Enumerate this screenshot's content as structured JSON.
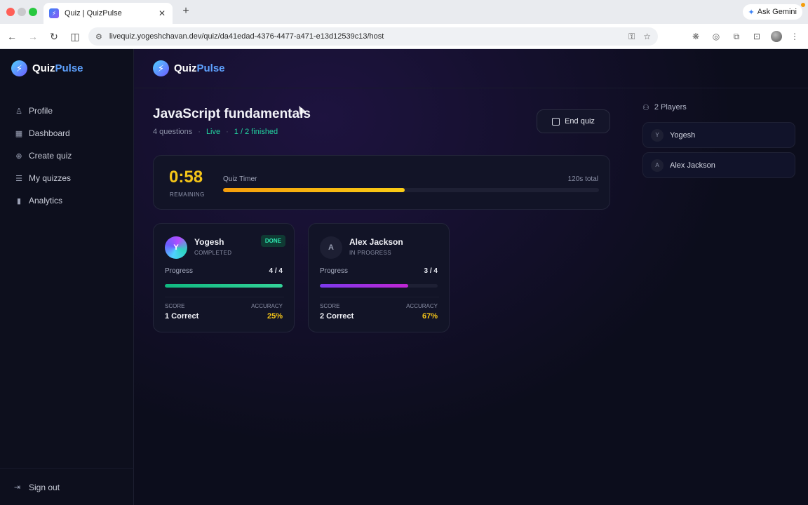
{
  "browser": {
    "tab_title": "Quiz | QuizPulse",
    "tab_favicon": "⚡",
    "url": "livequiz.yogeshchavan.dev/quiz/da41edad-4376-4477-a471-e13d12539c13/host",
    "gemini_label": "Ask Gemini"
  },
  "brand": {
    "name_part1": "Quiz",
    "name_part2": "Pulse"
  },
  "sidebar": {
    "items": [
      {
        "label": "Profile",
        "icon": "user-icon"
      },
      {
        "label": "Dashboard",
        "icon": "grid-icon"
      },
      {
        "label": "Create quiz",
        "icon": "plus-circle-icon"
      },
      {
        "label": "My quizzes",
        "icon": "list-icon"
      },
      {
        "label": "Analytics",
        "icon": "bar-chart-icon"
      }
    ],
    "signout": "Sign out"
  },
  "quiz": {
    "title": "JavaScript fundamentals",
    "questions": "4 questions",
    "status": "Live",
    "finished": "1 / 2 finished",
    "end_label": "End quiz"
  },
  "timer": {
    "value": "0:58",
    "label": "REMAINING",
    "bar_label": "Quiz Timer",
    "total": "120s total",
    "fraction": 0.483
  },
  "cards": [
    {
      "initial": "Y",
      "name": "Yogesh",
      "status": "COMPLETED",
      "badge": "DONE",
      "progress_label": "Progress",
      "progress": "4 / 4",
      "progress_fraction": 1.0,
      "score_label": "SCORE",
      "score": "1 Correct",
      "accuracy_label": "ACCURACY",
      "accuracy": "25%"
    },
    {
      "initial": "A",
      "name": "Alex Jackson",
      "status": "IN PROGRESS",
      "progress_label": "Progress",
      "progress": "3 / 4",
      "progress_fraction": 0.75,
      "score_label": "SCORE",
      "score": "2 Correct",
      "accuracy_label": "ACCURACY",
      "accuracy": "67%"
    }
  ],
  "players": {
    "header": "2 Players",
    "list": [
      {
        "initial": "Y",
        "name": "Yogesh"
      },
      {
        "initial": "A",
        "name": "Alex Jackson"
      }
    ]
  },
  "colors": {
    "accent_yellow": "#f5c518",
    "live_green": "#22d3a0",
    "progress_green": "#10b981",
    "progress_purple": "#7c3aed",
    "brand_blue": "#5ea2ff"
  }
}
